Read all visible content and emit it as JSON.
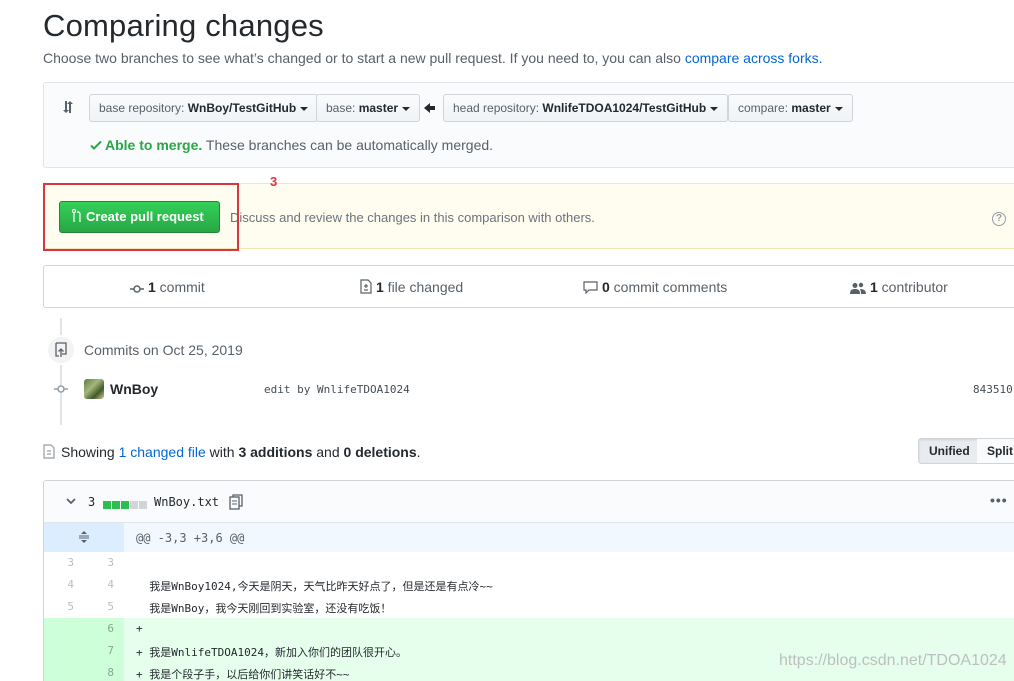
{
  "page": {
    "title": "Comparing changes",
    "subtitle": "Choose two branches to see what’s changed or to start a new pull request. If you need to, you can also ",
    "subtitle_link": "compare across forks."
  },
  "range": {
    "base_repo_label": "base repository: ",
    "base_repo_value": "WnBoy/TestGitHub",
    "base_label": "base: ",
    "base_value": "master",
    "head_repo_label": "head repository: ",
    "head_repo_value": "WnlifeTDOA1024/TestGitHub",
    "compare_label": "compare: ",
    "compare_value": "master",
    "merge_ok": "Able to merge.",
    "merge_text": " These branches can be automatically merged."
  },
  "pr": {
    "button_label": "Create pull request",
    "description": "Discuss and review the changes in this comparison with others.",
    "help": "?",
    "annotation_number": "3"
  },
  "numbers": {
    "commits_count": "1",
    "commits_label": " commit",
    "files_count": "1",
    "files_label": " file changed",
    "comments_count": "0",
    "comments_label": " commit comments",
    "contributors_count": "1",
    "contributors_label": " contributor"
  },
  "commits": {
    "date_label": "Commits on Oct 25, 2019",
    "author": "WnBoy",
    "message": "edit by WnlifeTDOA1024",
    "sha": "843510"
  },
  "diff_summary": {
    "prefix": "Showing ",
    "changed_link": "1 changed file",
    "with": " with ",
    "additions": "3 additions",
    "and": " and ",
    "deletions": "0 deletions",
    "suffix": ".",
    "unified_label": "Unified",
    "split_label": "Split"
  },
  "file": {
    "change_count": "3",
    "filename": "WnBoy.txt",
    "more": "•••",
    "hunk_header": "@@ -3,3 +3,6 @@",
    "lines": [
      {
        "old": "3",
        "new": "3",
        "text": "",
        "type": "ctx"
      },
      {
        "old": "4",
        "new": "4",
        "text": "  我是WnBoy1024,今天是阴天，天气比昨天好点了，但是还是有点冷~~",
        "type": "ctx"
      },
      {
        "old": "5",
        "new": "5",
        "text": "  我是WnBoy，我今天刚回到实验室，还没有吃饭！",
        "type": "ctx"
      },
      {
        "old": "",
        "new": "6",
        "text": "+",
        "type": "add"
      },
      {
        "old": "",
        "new": "7",
        "text": "+ 我是WnlifeTDOA1024，新加入你们的团队很开心。",
        "type": "add"
      },
      {
        "old": "",
        "new": "8",
        "text": "+ 我是个段子手，以后给你们讲笑话好不~~",
        "type": "add"
      }
    ]
  },
  "watermark": "https://blog.csdn.net/TDOA1024",
  "colors": {
    "green_button": "#28a745",
    "link": "#0366d6",
    "annotation_red": "#d9363e",
    "addition_bg": "#e6ffed"
  }
}
